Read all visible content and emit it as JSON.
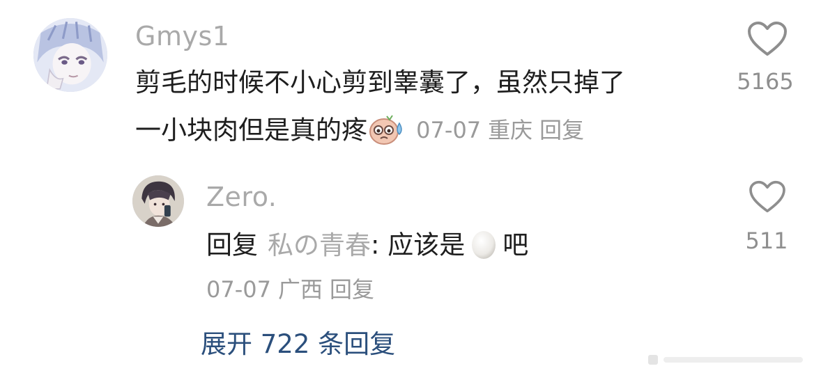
{
  "comments": [
    {
      "username": "Gmys1",
      "text_line1": "剪毛的时候不小心剪到睾囊了，虽然只掉了",
      "text_line2": "一小块肉但是真的疼",
      "emoji": "sweat-face-emoji",
      "date": "07-07",
      "location": "重庆",
      "reply_label": "回复",
      "likes": "5165"
    }
  ],
  "reply": {
    "username": "Zero.",
    "prefix": "回复",
    "target": "私の青春",
    "colon_text": ": 应该是",
    "emoji": "egg-emoji",
    "suffix": "吧",
    "date": "07-07",
    "location": "广西",
    "reply_label": "回复",
    "likes": "511"
  },
  "expand_label": "展开 722 条回复",
  "colors": {
    "username": "#a9a9a9",
    "text": "#1e1e1e",
    "meta": "#9a9a9a",
    "expand": "#2b4f7c"
  }
}
